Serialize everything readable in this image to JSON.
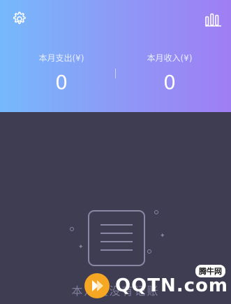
{
  "header": {
    "colors": {
      "gradient_start": "#76b9fb",
      "gradient_end": "#9f7ef3"
    },
    "settings_icon": "gear-icon",
    "stats_icon": "bar-chart-icon",
    "expense": {
      "label": "本月支出(¥)",
      "value": "0"
    },
    "income": {
      "label": "本月收入(¥)",
      "value": "0"
    }
  },
  "empty_state": {
    "icon": "document-lines-icon",
    "text": "本月还没有记账"
  },
  "watermark": {
    "brand": "QQTN.com",
    "sub": "腾牛网"
  }
}
